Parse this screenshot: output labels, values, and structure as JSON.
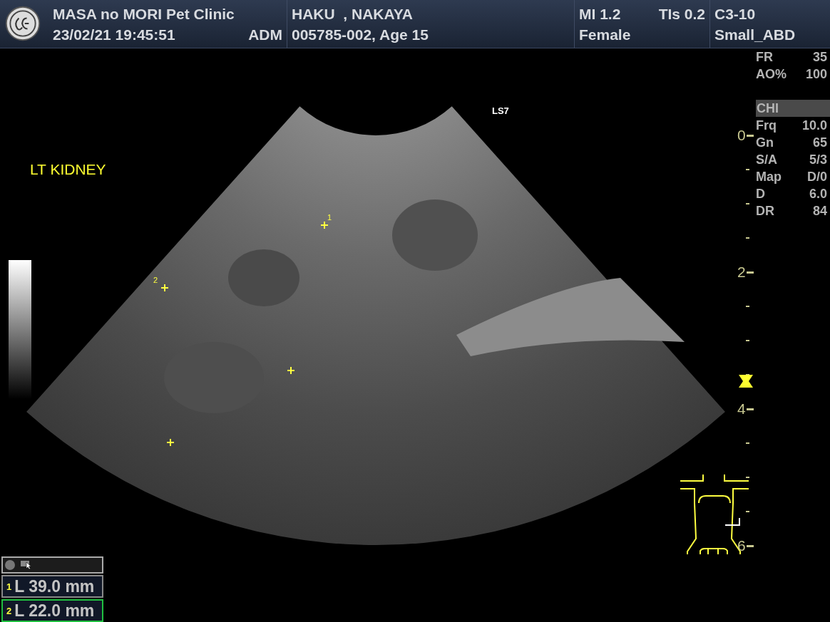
{
  "header": {
    "clinic": "MASA no MORI Pet Clinic",
    "datetime": "23/02/21 19:45:51",
    "operator": "ADM",
    "patient_name": "HAKU  , NAKAYA",
    "patient_id": "005785-002, Age 15",
    "mi": "MI 1.2",
    "tis": "TIs 0.2",
    "sex": "Female",
    "probe": "C3-10",
    "preset": "Small_ABD"
  },
  "image": {
    "annotation": "LT KIDNEY",
    "probe_mark": "LS7",
    "calipers": [
      {
        "label": "1"
      },
      {
        "label": "2"
      }
    ]
  },
  "parameters": {
    "top": [
      {
        "name": "FR",
        "value": "35"
      },
      {
        "name": "AO%",
        "value": "100"
      }
    ],
    "mode": "CHI",
    "list": [
      {
        "name": "Frq",
        "value": "10.0"
      },
      {
        "name": "Gn",
        "value": "65"
      },
      {
        "name": "S/A",
        "value": "5/3"
      },
      {
        "name": "Map",
        "value": "D/0"
      },
      {
        "name": "D",
        "value": "6.0"
      },
      {
        "name": "DR",
        "value": "84"
      }
    ]
  },
  "depth_scale": [
    "0",
    "2",
    "4",
    "6"
  ],
  "measurements": [
    {
      "index": "1",
      "value": "L 39.0 mm",
      "selected": false
    },
    {
      "index": "2",
      "value": "L 22.0 mm",
      "selected": true
    }
  ]
}
